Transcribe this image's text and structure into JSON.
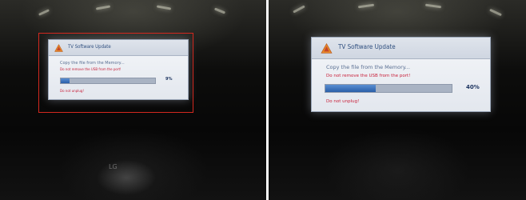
{
  "screens": [
    {
      "title": "TV Software Update",
      "message": "Copy the file from the Memory...",
      "warning_usb": "Do not remove the USB from the port!",
      "progress_percent": 9,
      "progress_label": "9%",
      "warning_unplug": "Do not unplug!"
    },
    {
      "title": "TV Software Update",
      "message": "Copy the file from the Memory...",
      "warning_usb": "Do not remove the USB from the port!",
      "progress_percent": 40,
      "progress_label": "40%",
      "warning_unplug": "Do not unplug!"
    }
  ],
  "tv_brand": "LG",
  "colors": {
    "highlight_box": "#d2281f",
    "warning_text": "#c8203a",
    "progress_fill": "#2a5fa8",
    "warning_icon": "#e8892a"
  },
  "icons": {
    "warning": "warning-triangle-icon"
  }
}
